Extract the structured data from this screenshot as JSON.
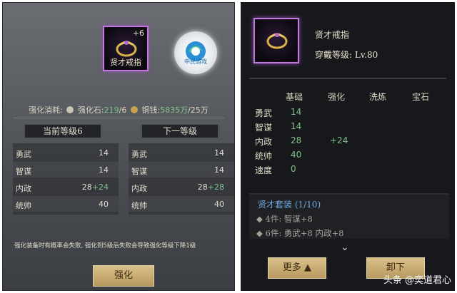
{
  "left": {
    "item": {
      "plus": "+6",
      "name": "贤才戒指"
    },
    "emblem_text": "中民游戏",
    "cost": {
      "label": "强化消耗:",
      "stone_label": "强化石:",
      "stone_have": "219",
      "stone_need": "/6",
      "coin_label": "铜钱:",
      "coin_have": "5835万",
      "coin_need": "/25万"
    },
    "current_level_label": "当前等级6",
    "next_level_label": "下一等级",
    "current_stats": [
      {
        "name": "勇武",
        "value": "14",
        "bonus": ""
      },
      {
        "name": "智谋",
        "value": "14",
        "bonus": ""
      },
      {
        "name": "内政",
        "value": "28",
        "bonus": "+24"
      },
      {
        "name": "统帅",
        "value": "40",
        "bonus": ""
      }
    ],
    "next_stats": [
      {
        "name": "勇武",
        "value": "14",
        "bonus": ""
      },
      {
        "name": "智谋",
        "value": "14",
        "bonus": ""
      },
      {
        "name": "内政",
        "value": "28",
        "bonus": "+28"
      },
      {
        "name": "统帅",
        "value": "40",
        "bonus": ""
      }
    ],
    "notice": "强化装备时有概率会失败, 强化到5级后失败会导致强化等级下降1级",
    "strengthen_button": "强化"
  },
  "right": {
    "item_name": "贤才戒指",
    "equip_level": "穿戴等级: Lv.80",
    "headers": [
      "基础",
      "强化",
      "洗炼",
      "宝石"
    ],
    "rows": [
      {
        "name": "勇武",
        "base": "14",
        "enhance": ""
      },
      {
        "name": "智谋",
        "base": "14",
        "enhance": ""
      },
      {
        "name": "内政",
        "base": "28",
        "enhance": "+24"
      },
      {
        "name": "统帅",
        "base": "40",
        "enhance": ""
      },
      {
        "name": "速度",
        "base": "0",
        "enhance": ""
      }
    ],
    "set_title": "贤才套装 (1/10)",
    "set_lines": [
      "◆ 4件: 智谋+8",
      "◆ 6件: 勇武+8 内政+8"
    ],
    "more_button": "更多 ▲",
    "unequip_button": "卸下"
  },
  "watermark": "头条 @奕道君心",
  "colors": {
    "green": "#7ec48a",
    "set_blue": "#6fa9e0",
    "gold_button": "#d9c089",
    "item_border": "#c47be0"
  }
}
